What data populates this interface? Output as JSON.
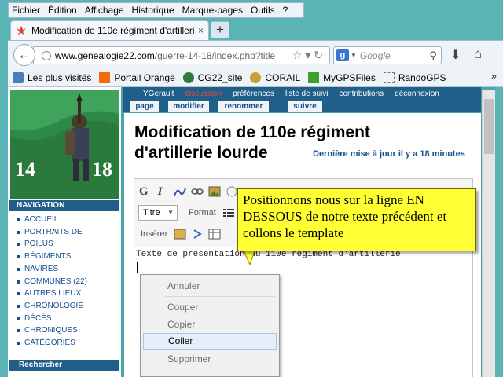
{
  "menubar": {
    "items": [
      "Fichier",
      "Édition",
      "Affichage",
      "Historique",
      "Marque-pages",
      "Outils",
      "?"
    ]
  },
  "browser": {
    "tab_title": "Modification de 110e régiment d'artilleri...",
    "tab_close": "×",
    "new_tab": "+",
    "url_domain": "www.genealogie22.com",
    "url_path": "/guerre-14-18/index.php?title",
    "search_engine_letter": "g",
    "search_placeholder": "Google"
  },
  "bookmarks": [
    "Les plus visités",
    "Portail Orange",
    "CG22_site",
    "CORAIL",
    "MyGPSFiles",
    "RandoGPS"
  ],
  "wiki": {
    "logo_left": "14",
    "logo_right": "18",
    "nav_heading": "NAVIGATION",
    "nav_items": [
      "ACCUEIL",
      "PORTRAITS DE",
      "POILUS",
      "RÉGIMENTS",
      "NAVIRES",
      "COMMUNES (22)",
      "AUTRES LIEUX",
      "CHRONOLOGIE",
      "DÉCÈS",
      "CHRONIQUES",
      "CATÉGORIES"
    ],
    "search_heading": "Rechercher",
    "user_links": [
      "YGerault",
      "discussion",
      "préférences",
      "liste de suivi",
      "contributions",
      "déconnexion"
    ],
    "page_tabs": [
      "page",
      "modifier",
      "renommer",
      "suivre"
    ],
    "title_line1": "Modification de 110e régiment",
    "title_line2": "d'artillerie lourde",
    "last_modified": "Dernière mise à jour il y a 18 minutes",
    "toolbar_bold": "G",
    "toolbar_italic": "I",
    "format_select": "Titre",
    "format_label": "Format",
    "insert_label": "Insérer",
    "text_content": "Texte de présentation du 110e régiment d'artillerie"
  },
  "context_menu": {
    "items": [
      {
        "label": "Annuler",
        "enabled": false
      },
      {
        "label": "Couper",
        "enabled": false
      },
      {
        "label": "Copier",
        "enabled": false
      },
      {
        "label": "Coller",
        "enabled": true
      },
      {
        "label": "Supprimer",
        "enabled": false
      }
    ]
  },
  "callout": {
    "text": "Positionnons nous sur la ligne EN DESSOUS de notre texte précédent et collons le template"
  },
  "colors": {
    "nav_blue": "#1f5f8a",
    "link_blue": "#174f93",
    "callout_yellow": "#ffff33",
    "page_teal": "#4aa7a8"
  }
}
